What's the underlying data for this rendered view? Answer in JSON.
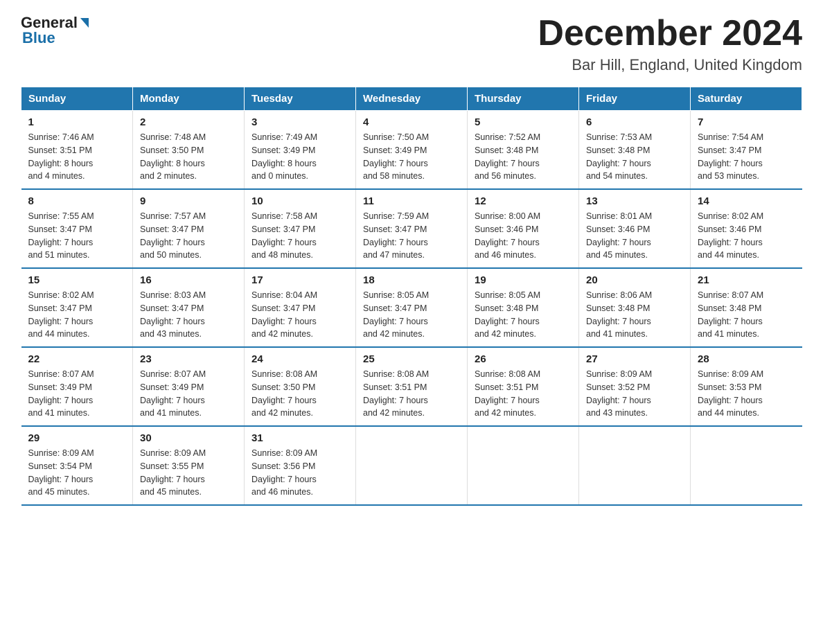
{
  "header": {
    "logo": {
      "general": "General",
      "blue": "Blue"
    },
    "title": "December 2024",
    "subtitle": "Bar Hill, England, United Kingdom"
  },
  "columns": [
    "Sunday",
    "Monday",
    "Tuesday",
    "Wednesday",
    "Thursday",
    "Friday",
    "Saturday"
  ],
  "weeks": [
    [
      {
        "day": "1",
        "sunrise": "7:46 AM",
        "sunset": "3:51 PM",
        "daylight": "8 hours and 4 minutes."
      },
      {
        "day": "2",
        "sunrise": "7:48 AM",
        "sunset": "3:50 PM",
        "daylight": "8 hours and 2 minutes."
      },
      {
        "day": "3",
        "sunrise": "7:49 AM",
        "sunset": "3:49 PM",
        "daylight": "8 hours and 0 minutes."
      },
      {
        "day": "4",
        "sunrise": "7:50 AM",
        "sunset": "3:49 PM",
        "daylight": "7 hours and 58 minutes."
      },
      {
        "day": "5",
        "sunrise": "7:52 AM",
        "sunset": "3:48 PM",
        "daylight": "7 hours and 56 minutes."
      },
      {
        "day": "6",
        "sunrise": "7:53 AM",
        "sunset": "3:48 PM",
        "daylight": "7 hours and 54 minutes."
      },
      {
        "day": "7",
        "sunrise": "7:54 AM",
        "sunset": "3:47 PM",
        "daylight": "7 hours and 53 minutes."
      }
    ],
    [
      {
        "day": "8",
        "sunrise": "7:55 AM",
        "sunset": "3:47 PM",
        "daylight": "7 hours and 51 minutes."
      },
      {
        "day": "9",
        "sunrise": "7:57 AM",
        "sunset": "3:47 PM",
        "daylight": "7 hours and 50 minutes."
      },
      {
        "day": "10",
        "sunrise": "7:58 AM",
        "sunset": "3:47 PM",
        "daylight": "7 hours and 48 minutes."
      },
      {
        "day": "11",
        "sunrise": "7:59 AM",
        "sunset": "3:47 PM",
        "daylight": "7 hours and 47 minutes."
      },
      {
        "day": "12",
        "sunrise": "8:00 AM",
        "sunset": "3:46 PM",
        "daylight": "7 hours and 46 minutes."
      },
      {
        "day": "13",
        "sunrise": "8:01 AM",
        "sunset": "3:46 PM",
        "daylight": "7 hours and 45 minutes."
      },
      {
        "day": "14",
        "sunrise": "8:02 AM",
        "sunset": "3:46 PM",
        "daylight": "7 hours and 44 minutes."
      }
    ],
    [
      {
        "day": "15",
        "sunrise": "8:02 AM",
        "sunset": "3:47 PM",
        "daylight": "7 hours and 44 minutes."
      },
      {
        "day": "16",
        "sunrise": "8:03 AM",
        "sunset": "3:47 PM",
        "daylight": "7 hours and 43 minutes."
      },
      {
        "day": "17",
        "sunrise": "8:04 AM",
        "sunset": "3:47 PM",
        "daylight": "7 hours and 42 minutes."
      },
      {
        "day": "18",
        "sunrise": "8:05 AM",
        "sunset": "3:47 PM",
        "daylight": "7 hours and 42 minutes."
      },
      {
        "day": "19",
        "sunrise": "8:05 AM",
        "sunset": "3:48 PM",
        "daylight": "7 hours and 42 minutes."
      },
      {
        "day": "20",
        "sunrise": "8:06 AM",
        "sunset": "3:48 PM",
        "daylight": "7 hours and 41 minutes."
      },
      {
        "day": "21",
        "sunrise": "8:07 AM",
        "sunset": "3:48 PM",
        "daylight": "7 hours and 41 minutes."
      }
    ],
    [
      {
        "day": "22",
        "sunrise": "8:07 AM",
        "sunset": "3:49 PM",
        "daylight": "7 hours and 41 minutes."
      },
      {
        "day": "23",
        "sunrise": "8:07 AM",
        "sunset": "3:49 PM",
        "daylight": "7 hours and 41 minutes."
      },
      {
        "day": "24",
        "sunrise": "8:08 AM",
        "sunset": "3:50 PM",
        "daylight": "7 hours and 42 minutes."
      },
      {
        "day": "25",
        "sunrise": "8:08 AM",
        "sunset": "3:51 PM",
        "daylight": "7 hours and 42 minutes."
      },
      {
        "day": "26",
        "sunrise": "8:08 AM",
        "sunset": "3:51 PM",
        "daylight": "7 hours and 42 minutes."
      },
      {
        "day": "27",
        "sunrise": "8:09 AM",
        "sunset": "3:52 PM",
        "daylight": "7 hours and 43 minutes."
      },
      {
        "day": "28",
        "sunrise": "8:09 AM",
        "sunset": "3:53 PM",
        "daylight": "7 hours and 44 minutes."
      }
    ],
    [
      {
        "day": "29",
        "sunrise": "8:09 AM",
        "sunset": "3:54 PM",
        "daylight": "7 hours and 45 minutes."
      },
      {
        "day": "30",
        "sunrise": "8:09 AM",
        "sunset": "3:55 PM",
        "daylight": "7 hours and 45 minutes."
      },
      {
        "day": "31",
        "sunrise": "8:09 AM",
        "sunset": "3:56 PM",
        "daylight": "7 hours and 46 minutes."
      },
      null,
      null,
      null,
      null
    ]
  ],
  "labels": {
    "sunrise": "Sunrise:",
    "sunset": "Sunset:",
    "daylight": "Daylight:"
  }
}
